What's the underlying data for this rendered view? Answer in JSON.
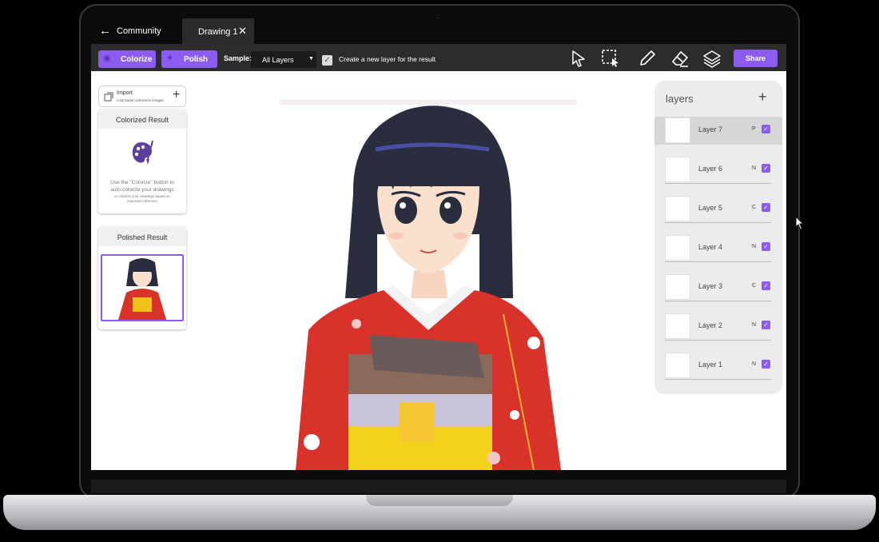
{
  "titlebar": {
    "back_label": "Community",
    "tab_label": "Drawing 1"
  },
  "toolbar": {
    "colorize_label": "Colorize",
    "polish_label": "Polish",
    "sample_label": "Sample:",
    "sample_value": "All Layers",
    "new_layer_checkbox_label": "Create a new layer for the result",
    "share_label": "Share"
  },
  "import": {
    "title": "Import",
    "subtitle": "colorization reference images"
  },
  "colorized": {
    "title": "Colorized Result",
    "line1": "Use the \"Colorize\" button to",
    "line2": "auto-colorize your drawings",
    "line3": "or colorize your drawings based on",
    "line4": "imported reference"
  },
  "polished": {
    "title": "Polished Result"
  },
  "layers": {
    "title": "layers",
    "items": [
      {
        "name": "Layer 7",
        "mode": "P",
        "active": true
      },
      {
        "name": "Layer 6",
        "mode": "N"
      },
      {
        "name": "Layer 5",
        "mode": "C"
      },
      {
        "name": "Layer 4",
        "mode": "N"
      },
      {
        "name": "Layer 3",
        "mode": "C"
      },
      {
        "name": "Layer 2",
        "mode": "N"
      },
      {
        "name": "Layer 1",
        "mode": "N"
      }
    ]
  },
  "colors": {
    "accent": "#8c5cf0",
    "kimono": "#d9322b",
    "hair": "#2a2d3d"
  }
}
